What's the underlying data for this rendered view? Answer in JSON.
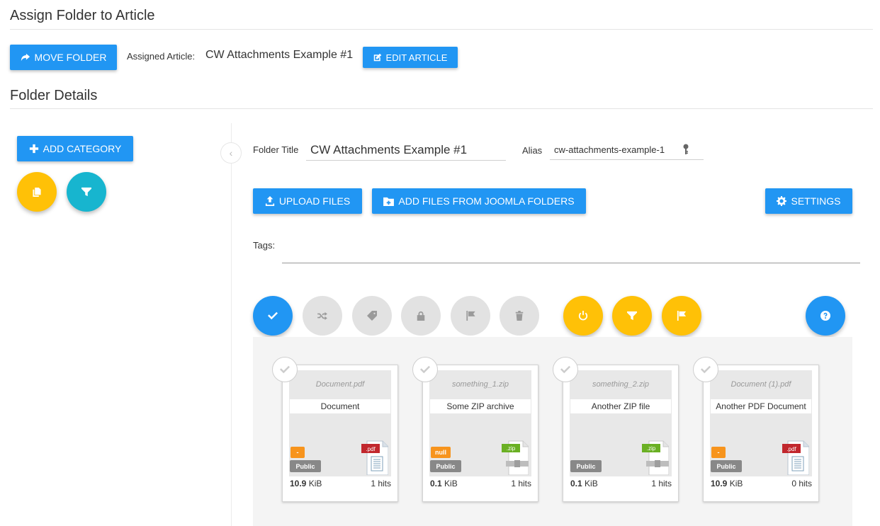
{
  "header": {
    "title": "Assign Folder to Article"
  },
  "toolbar": {
    "move_folder": "MOVE FOLDER",
    "assigned_label": "Assigned Article:",
    "assigned_value": "CW Attachments Example #1",
    "edit_article": "EDIT ARTICLE"
  },
  "section": {
    "title": "Folder Details"
  },
  "sidebar": {
    "add_category": "ADD CATEGORY"
  },
  "folder": {
    "title_label": "Folder Title",
    "title_value": "CW Attachments Example #1",
    "alias_label": "Alias",
    "alias_value": "cw-attachments-example-1",
    "tags_label": "Tags:"
  },
  "actions": {
    "upload": "UPLOAD FILES",
    "add_from_joomla": "ADD FILES FROM JOOMLA FOLDERS",
    "settings": "SETTINGS"
  },
  "colors": {
    "primary": "#2196f3",
    "accent_yellow": "#ffc107",
    "accent_cyan": "#17b5cf",
    "badge_orange": "#f7941d"
  },
  "files": [
    {
      "filename": "Document.pdf",
      "title": "Document",
      "state": "-",
      "access": "Public",
      "size_value": "10.9",
      "size_unit": " KiB",
      "hits": "1 hits",
      "ext": ".pdf",
      "icon": "pdf-file-icon"
    },
    {
      "filename": "something_1.zip",
      "title": "Some ZIP archive",
      "state": "null",
      "access": "Public",
      "size_value": "0.1",
      "size_unit": " KiB",
      "hits": "1 hits",
      "ext": ".zip",
      "icon": "zip-file-icon"
    },
    {
      "filename": "something_2.zip",
      "title": "Another ZIP file",
      "state": "",
      "access": "Public",
      "size_value": "0.1",
      "size_unit": " KiB",
      "hits": "1 hits",
      "ext": ".zip",
      "icon": "zip-file-icon"
    },
    {
      "filename": "Document (1).pdf",
      "title": "Another PDF Document",
      "state": "-",
      "access": "Public",
      "size_value": "10.9",
      "size_unit": " KiB",
      "hits": "0 hits",
      "ext": ".pdf",
      "icon": "pdf-file-icon"
    }
  ]
}
